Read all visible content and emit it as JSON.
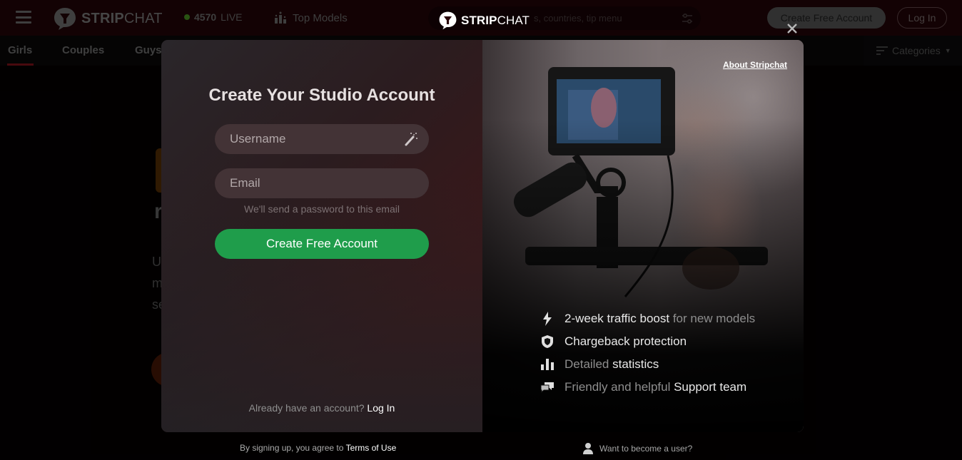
{
  "background": {
    "brand": {
      "bold": "STRIP",
      "light": "CHAT"
    },
    "live": {
      "count": "4570",
      "label": "LIVE",
      "dot_color": "#5bb82a"
    },
    "top_models_label": "Top Models",
    "search_placeholder": "s, countries, tip menu",
    "create_account_label": "Create Free Account",
    "login_label": "Log In",
    "subnav": [
      {
        "label": "Girls",
        "active": true
      },
      {
        "label": "Couples",
        "active": false
      },
      {
        "label": "Guys",
        "active": false
      }
    ],
    "categories_label": "Categories",
    "hero_fragments": {
      "heading_letter": "r",
      "line1": "U",
      "line2": "m",
      "line3": "se"
    }
  },
  "header_brand": {
    "bold": "STRIP",
    "light": "CHAT"
  },
  "modal": {
    "title": "Create Your Studio Account",
    "username_placeholder": "Username",
    "email_placeholder": "Email",
    "email_hint": "We'll send a password to this email",
    "submit_label": "Create Free Account",
    "already_text": "Already have an account?",
    "already_link": "Log In",
    "about_link": "About Stripchat",
    "features": [
      {
        "icon": "lightning-icon",
        "highlight": "2-week traffic boost",
        "rest": " for new models",
        "highlight_first": true
      },
      {
        "icon": "shield-icon",
        "highlight": "Chargeback protection",
        "rest": "",
        "highlight_first": true
      },
      {
        "icon": "bar-chart-icon",
        "pre": "Detailed ",
        "highlight": "statistics",
        "highlight_first": false
      },
      {
        "icon": "chat-bubbles-icon",
        "pre": "Friendly and helpful ",
        "highlight": "Support team",
        "highlight_first": false
      }
    ],
    "submit_color": "#1f9d4b"
  },
  "footer": {
    "terms_text": "By signing up, you agree to",
    "terms_link": "Terms of Use",
    "become_user": "Want to become a user?"
  }
}
